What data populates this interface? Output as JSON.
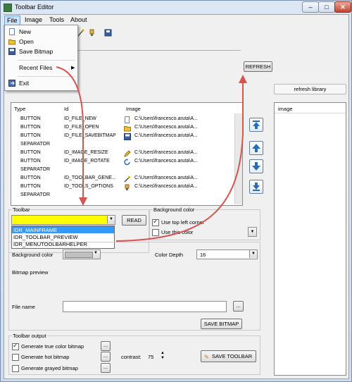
{
  "window": {
    "title": "Toolbar Editor"
  },
  "menu": {
    "file": "File",
    "image": "Image",
    "tools": "Tools",
    "about": "About"
  },
  "file_menu": {
    "new": "New",
    "open": "Open",
    "save_bitmap": "Save Bitmap",
    "recent_files": "Recent Files",
    "exit": "Exit"
  },
  "buttons": {
    "refresh": "REFRESH",
    "read": "READ",
    "save_bitmap": "SAVE BITMAP",
    "save_toolbar": "SAVE TOOLBAR",
    "browse": "...",
    "min": "–",
    "max": "□",
    "close": "✕"
  },
  "library": {
    "refresh": "refresh library",
    "column": "image"
  },
  "table": {
    "headers": {
      "type": "Type",
      "id": "Id",
      "image": "Image"
    },
    "rows": [
      {
        "type": "BUTTON",
        "id": "ID_FILE_NEW",
        "image": "C:\\Users\\francesco.aruta\\A..."
      },
      {
        "type": "BUTTON",
        "id": "ID_FILE_OPEN",
        "image": "C:\\Users\\francesco.aruta\\A..."
      },
      {
        "type": "BUTTON",
        "id": "ID_FILE_SAVEBITMAP",
        "image": "C:\\Users\\francesco.aruta\\A..."
      },
      {
        "type": "SEPARATOR",
        "id": "",
        "image": ""
      },
      {
        "type": "BUTTON",
        "id": "ID_IMAGE_RESIZE",
        "image": "C:\\Users\\francesco.aruta\\A..."
      },
      {
        "type": "BUTTON",
        "id": "ID_IMAGE_ROTATE",
        "image": "C:\\Users\\francesco.aruta\\A..."
      },
      {
        "type": "SEPARATOR",
        "id": "",
        "image": ""
      },
      {
        "type": "BUTTON",
        "id": "ID_TOOLBAR_GENE...",
        "image": "C:\\Users\\francesco.aruta\\A..."
      },
      {
        "type": "BUTTON",
        "id": "ID_TOOLS_OPTIONS",
        "image": "C:\\Users\\francesco.aruta\\A..."
      },
      {
        "type": "SEPARATOR",
        "id": "",
        "image": ""
      }
    ]
  },
  "toolbar_group": {
    "title": "Toolbar",
    "options": [
      "IDR_MAINFRAME",
      "IDR_TOOLBAR_PREVIEW",
      "IDR_MENUTOOLBARHELPER"
    ]
  },
  "bg_group": {
    "title": "Background color",
    "use_top_left": "Use top left corner",
    "use_this": "Use this color"
  },
  "bitmap": {
    "background_color": "Background color",
    "color_depth": "Color Depth",
    "color_depth_value": "16",
    "preview": "Bitmap preview",
    "file_name": "File name"
  },
  "output": {
    "title": "Toolbar output",
    "true_color": "Generate true color bitmap",
    "hot": "Generate hot bitmap",
    "grayed": "Generate grayed bitmap",
    "contrast": "contrast:",
    "contrast_value": "75"
  },
  "colors": {
    "highlight": "#3399ff",
    "yellow": "#ffff00",
    "arrow": "#d9534f"
  }
}
